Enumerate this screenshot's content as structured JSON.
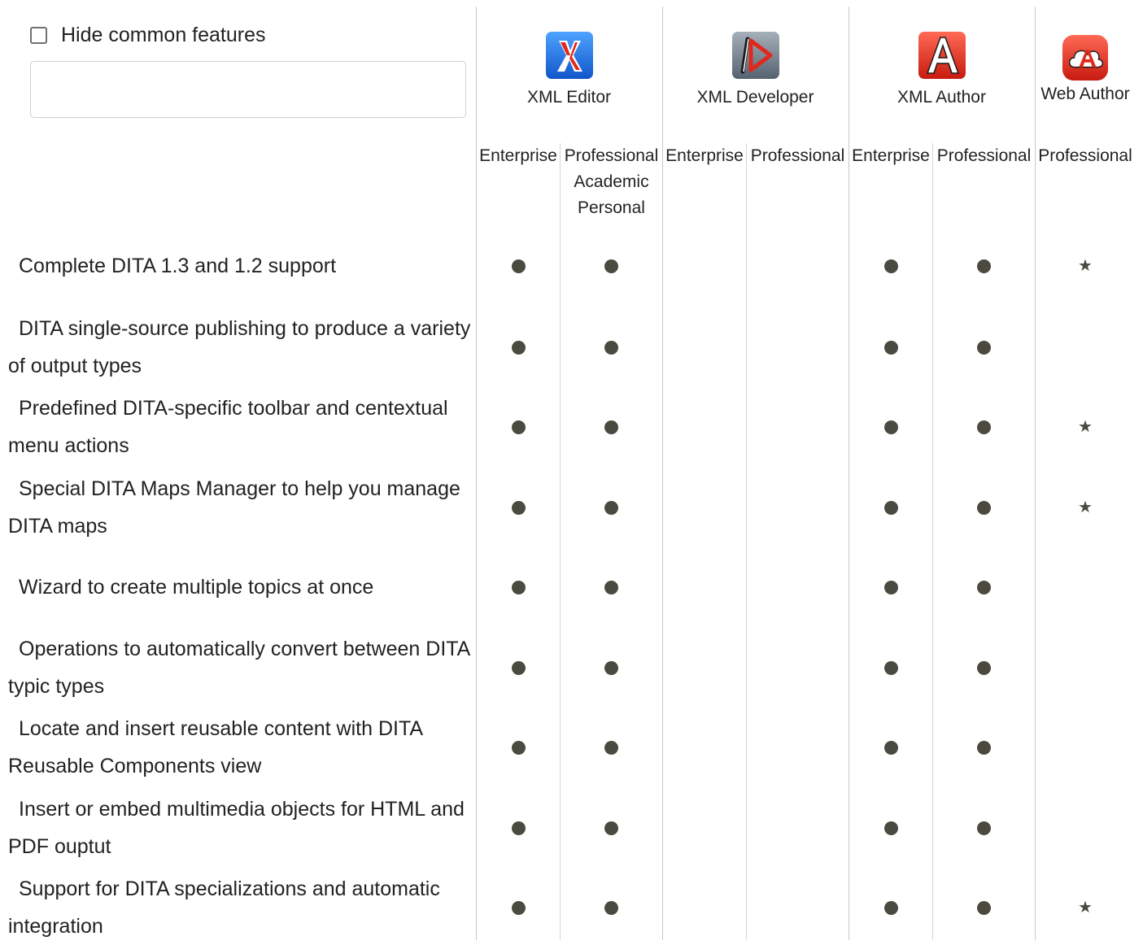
{
  "controls": {
    "hide_common_label": "Hide common features",
    "hide_common_checked": false,
    "filter_value": "",
    "filter_placeholder": ""
  },
  "products": [
    {
      "name": "XML Editor",
      "icon": "xml-editor-logo",
      "color": "#1f6fe0",
      "editions": [
        "Enterprise",
        "Professional\nAcademic\nPersonal"
      ]
    },
    {
      "name": "XML Developer",
      "icon": "xml-developer-logo",
      "color": "#6d7a86",
      "editions": [
        "Enterprise",
        "Professional"
      ]
    },
    {
      "name": "XML Author",
      "icon": "xml-author-logo",
      "color": "#e0281c",
      "editions": [
        "Enterprise",
        "Professional"
      ]
    },
    {
      "name": "Web Author",
      "icon": "web-author-logo",
      "color": "#e0281c",
      "editions": [
        "Professional"
      ]
    }
  ],
  "legend": {
    "dot": "supported",
    "star": "partially-supported"
  },
  "features": [
    {
      "label": "Complete DITA 1.3 and 1.2 support",
      "marks": [
        "dot",
        "dot",
        "",
        "",
        "dot",
        "dot",
        "star"
      ]
    },
    {
      "label": "DITA single-source publishing to produce a variety of output types",
      "marks": [
        "dot",
        "dot",
        "",
        "",
        "dot",
        "dot",
        ""
      ]
    },
    {
      "label": "Predefined DITA-specific toolbar and centextual menu actions",
      "marks": [
        "dot",
        "dot",
        "",
        "",
        "dot",
        "dot",
        "star"
      ]
    },
    {
      "label": "Special DITA Maps Manager to help you manage DITA maps",
      "marks": [
        "dot",
        "dot",
        "",
        "",
        "dot",
        "dot",
        "star"
      ]
    },
    {
      "label": "Wizard to create multiple topics at once",
      "marks": [
        "dot",
        "dot",
        "",
        "",
        "dot",
        "dot",
        ""
      ]
    },
    {
      "label": "Operations to automatically convert between DITA typic types",
      "marks": [
        "dot",
        "dot",
        "",
        "",
        "dot",
        "dot",
        ""
      ]
    },
    {
      "label": "Locate and insert reusable content with DITA Reusable Components view",
      "marks": [
        "dot",
        "dot",
        "",
        "",
        "dot",
        "dot",
        ""
      ]
    },
    {
      "label": "Insert or embed multimedia objects for HTML and PDF ouptut",
      "marks": [
        "dot",
        "dot",
        "",
        "",
        "dot",
        "dot",
        ""
      ]
    },
    {
      "label": "Support for DITA specializations and automatic integration",
      "marks": [
        "dot",
        "dot",
        "",
        "",
        "dot",
        "dot",
        "star"
      ]
    }
  ]
}
